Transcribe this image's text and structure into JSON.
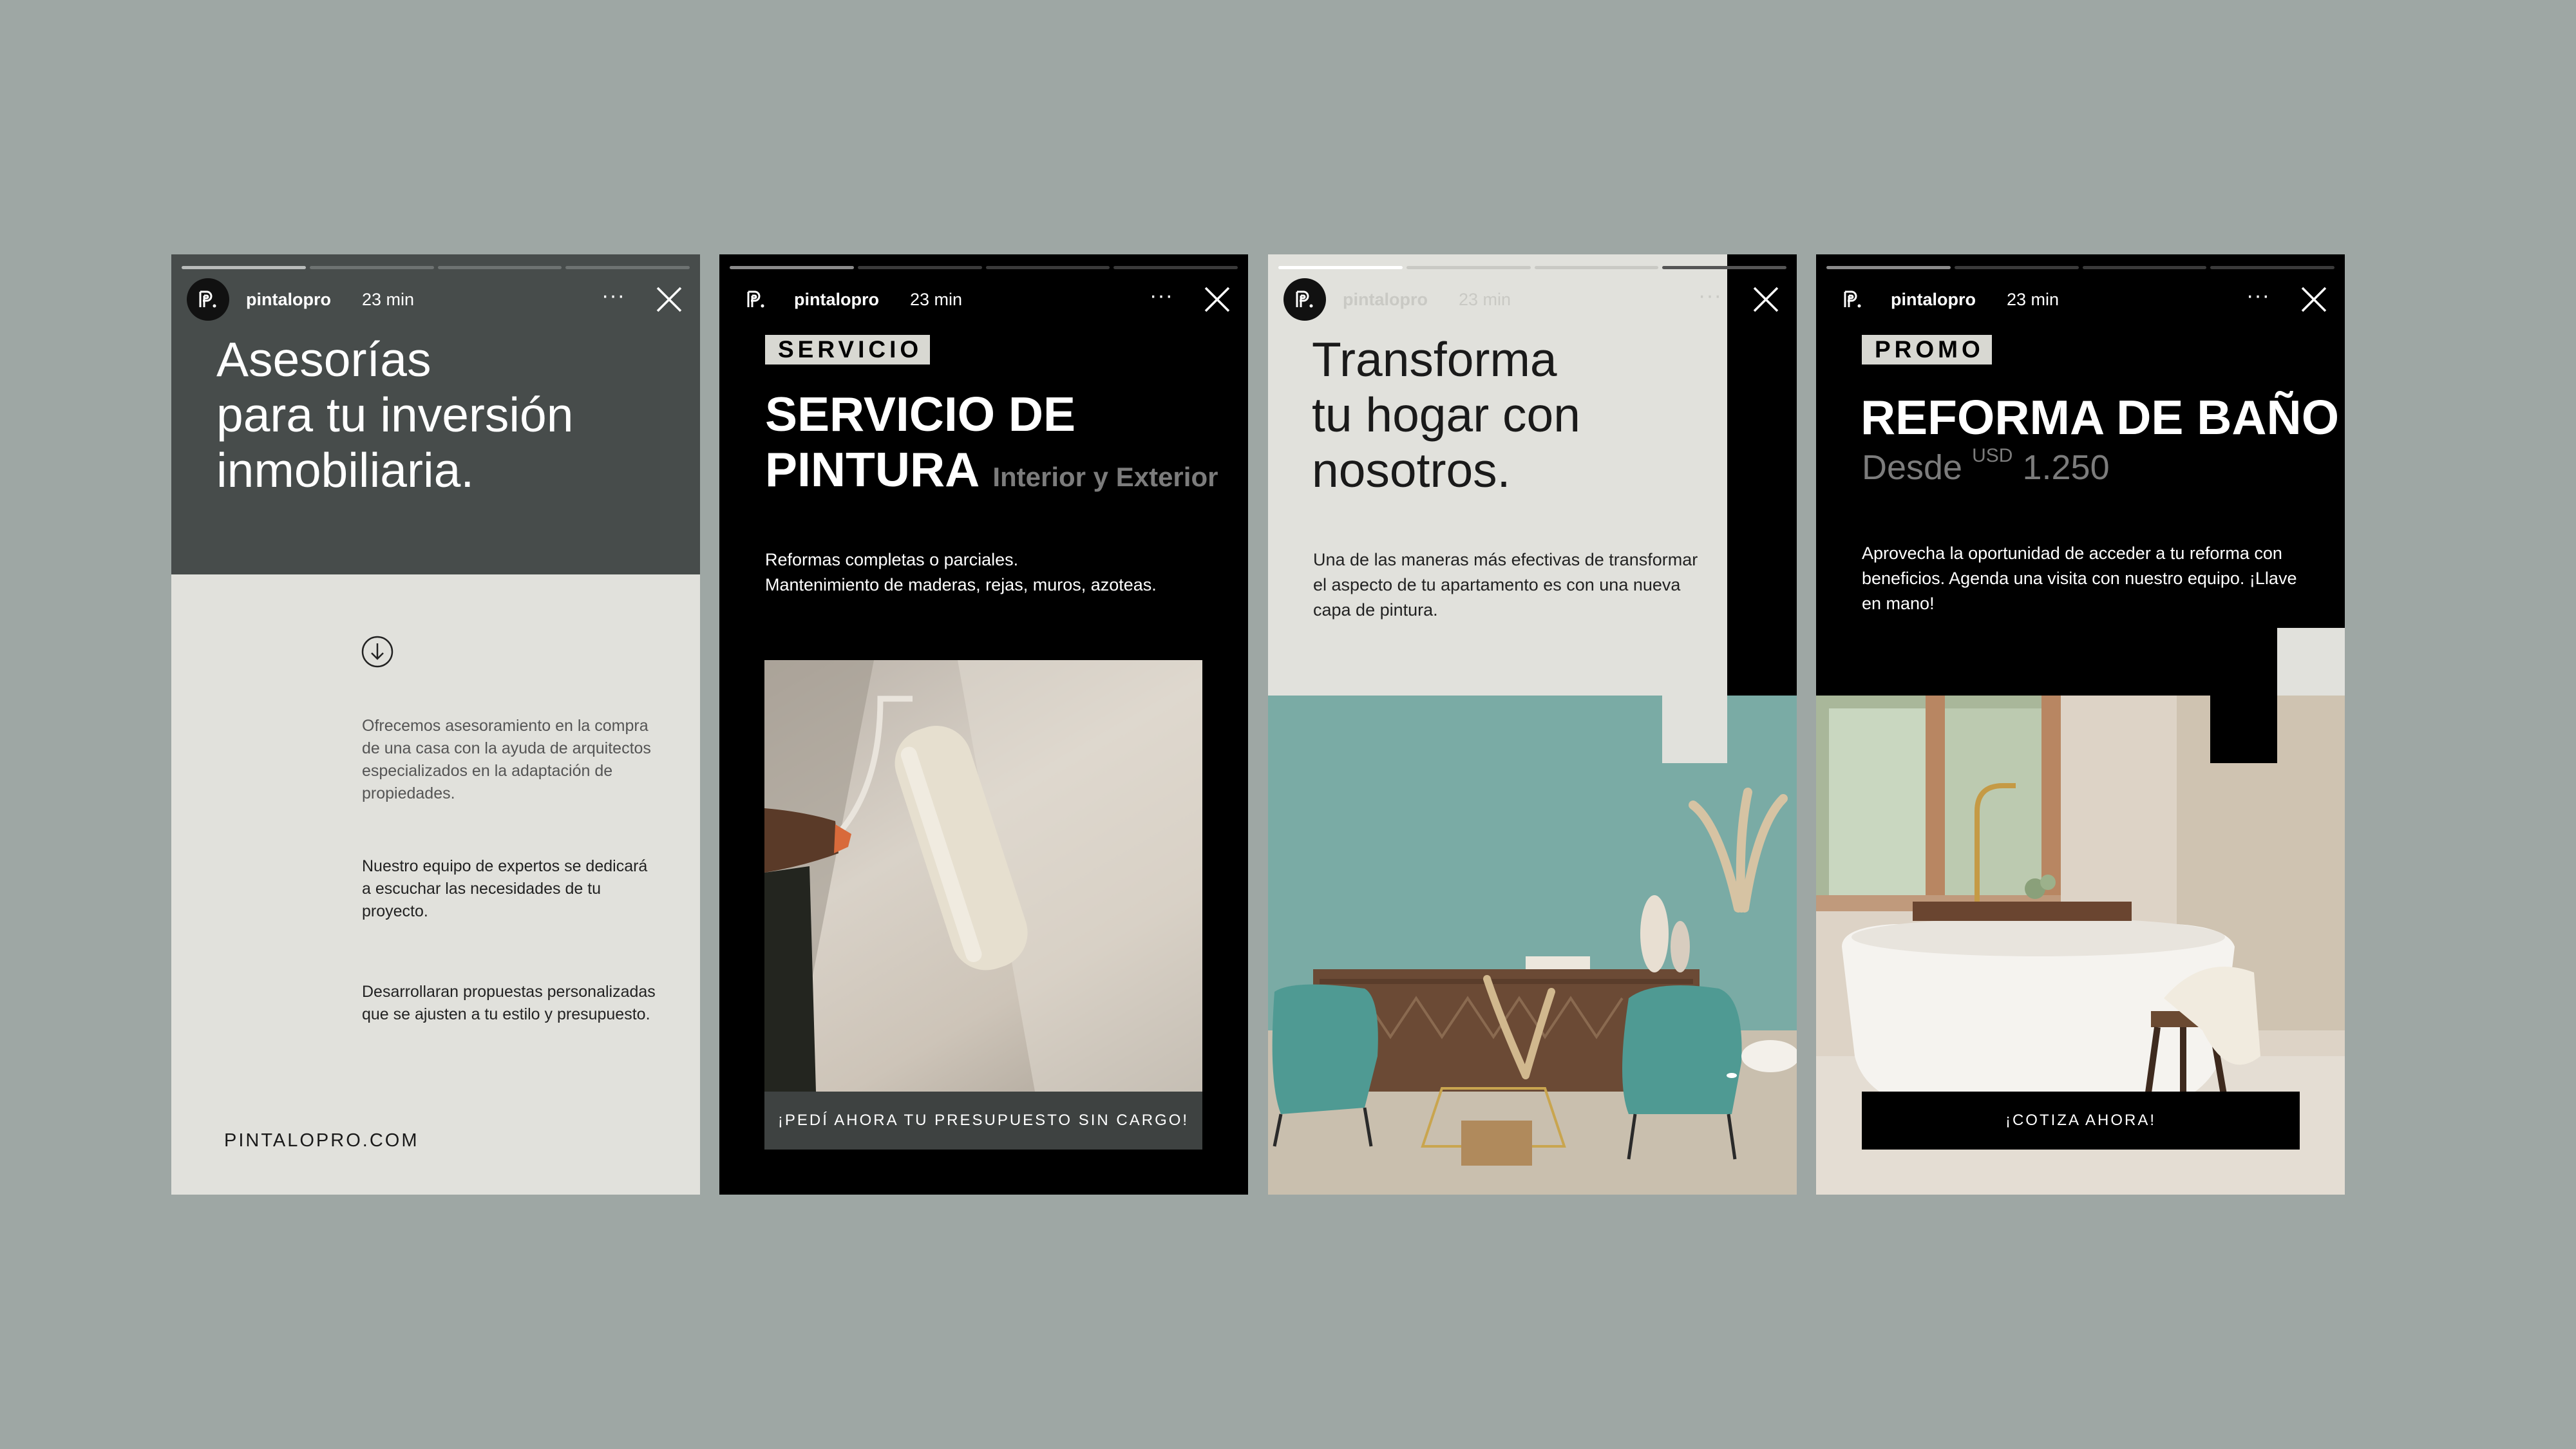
{
  "colors": {
    "background": "#9ea7a4",
    "dark_panel": "#474c4b",
    "light_panel": "#e1e1dc",
    "black": "#000000",
    "muted_text": "#7c7c7c"
  },
  "stories": [
    {
      "username": "pintalopro",
      "time": "23 min",
      "more_label": "···",
      "title_lines": [
        "Asesorías",
        "para tu inversión",
        "inmobiliaria."
      ],
      "icon": "arrow-down-circle-icon",
      "paragraphs": [
        "Ofrecemos asesoramiento en la compra de una casa con la ayuda de arquitectos especializados en la adaptación de propiedades.",
        "Nuestro equipo de expertos se dedicará a escuchar las necesidades de tu proyecto.",
        "Desarrollaran propuestas personalizadas que se ajusten a tu estilo y presupuesto."
      ],
      "footer": "PINTALOPRO.COM"
    },
    {
      "username": "pintalopro",
      "time": "23 min",
      "more_label": "···",
      "tag": "SERVICIO",
      "title_line1": "SERVICIO DE",
      "title_line2": "PINTURA",
      "subtitle": "Interior y Exterior",
      "desc_line1": "Reformas completas o parciales.",
      "desc_line2": "Mantenimiento de maderas, rejas, muros, azoteas.",
      "cta": "¡PEDÍ AHORA TU PRESUPUESTO SIN CARGO!"
    },
    {
      "username": "pintalopro",
      "time": "23 min",
      "more_label": "···",
      "title_lines": [
        "Transforma",
        "tu hogar con",
        "nosotros."
      ],
      "desc": "Una de las maneras más efectivas de transformar el aspecto de tu apartamento es con una nueva capa de pintura."
    },
    {
      "username": "pintalopro",
      "time": "23 min",
      "more_label": "···",
      "tag": "PROMO",
      "title": "REFORMA DE BAÑO",
      "price_prefix": "Desde",
      "currency": "USD",
      "price": "1.250",
      "desc": "Aprovecha la oportunidad de acceder a tu reforma con beneficios. Agenda una visita con nuestro equipo. ¡Llave en mano!",
      "cta": "¡COTIZA AHORA!"
    }
  ]
}
